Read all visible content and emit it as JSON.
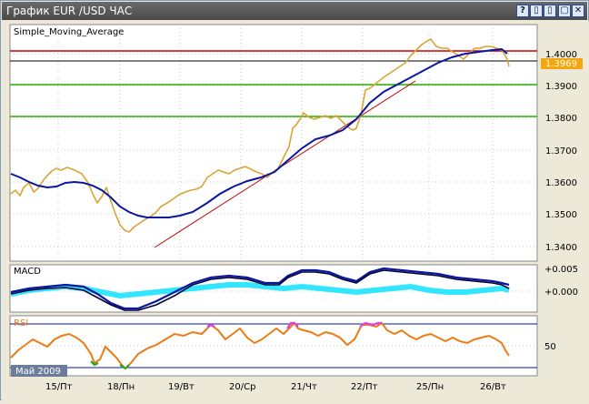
{
  "window": {
    "title": "График EUR /USD  ЧАС",
    "buttons": [
      "?",
      "▯",
      "▯",
      "▢",
      "✕"
    ]
  },
  "main_panel": {
    "indicator_label": "Simple_Moving_Average",
    "y_ticks": [
      "1.4000",
      "1.3900",
      "1.3800",
      "1.3700",
      "1.3600",
      "1.3500",
      "1.3400"
    ],
    "current_price": "1.3969",
    "colors": {
      "candles": "#d9a437",
      "sma": "#0a16a0",
      "trendline": "#c00000",
      "red_level": "#cc0000",
      "green_level": "#20b000",
      "current_line": "#000000"
    }
  },
  "macd_panel": {
    "label": "MACD",
    "y_ticks": [
      "+0.005",
      "+0.000"
    ],
    "colors": {
      "histogram": "#33e6ff",
      "signal": "#0a16a0",
      "macd": "#000033"
    }
  },
  "rsi_panel": {
    "label": "RSI",
    "y_ticks": [
      "50"
    ],
    "colors": {
      "line": "#ee7a12",
      "overbought": "#e03ee0",
      "oversold": "#22aa22"
    }
  },
  "x_axis": {
    "month_badge": "Май 2009",
    "labels": [
      "15/Пт",
      "18/Пн",
      "19/Вт",
      "20/Ср",
      "21/Чт",
      "22/Пт",
      "25/Пн",
      "26/Вт"
    ]
  },
  "chart_data": [
    {
      "type": "line",
      "title": "",
      "series": [
        {
          "name": "Simple_Moving_Average",
          "x": [
            "15/Пт",
            "18/Пн",
            "19/Вт",
            "20/Ср",
            "21/Чт",
            "22/Пт",
            "25/Пн",
            "26/Вт"
          ],
          "values": [
            1.3625,
            1.353,
            1.353,
            1.3585,
            1.3665,
            1.3815,
            1.3965,
            1.4
          ]
        }
      ],
      "levels": [
        1.4008,
        1.3969,
        1.39,
        1.38
      ],
      "ylim": [
        1.337,
        1.406
      ]
    },
    {
      "type": "line",
      "series": [
        {
          "name": "MACD",
          "x": [
            "15/Пт",
            "18/Пн",
            "19/Вт",
            "20/Ср",
            "21/Чт",
            "22/Пт",
            "25/Пн",
            "26/Вт"
          ],
          "values": [
            0.001,
            -0.003,
            -0.001,
            0.001,
            0.004,
            0.001,
            0.004,
            0.001
          ]
        }
      ],
      "ylim": [
        -0.004,
        0.006
      ]
    },
    {
      "type": "line",
      "series": [
        {
          "name": "RSI",
          "x": [
            "15/Пт",
            "18/Пн",
            "19/Вт",
            "20/Ср",
            "21/Чт",
            "22/Пт",
            "25/Пн",
            "26/Вт"
          ],
          "values": [
            55,
            35,
            45,
            60,
            72,
            70,
            65,
            45
          ]
        }
      ],
      "ylim": [
        0,
        100
      ]
    }
  ]
}
